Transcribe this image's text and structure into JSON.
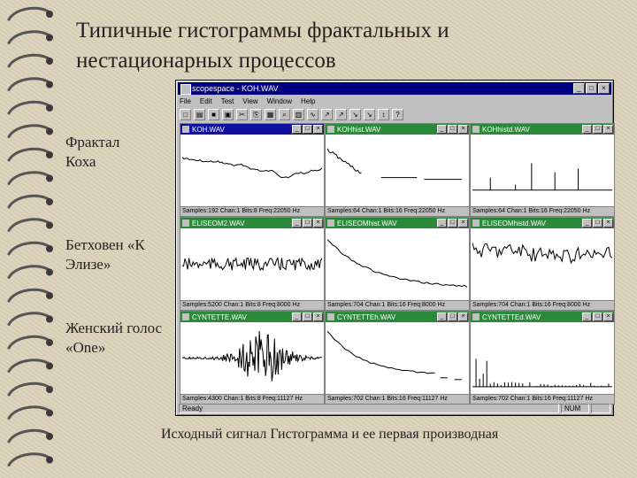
{
  "slide": {
    "title": "Типичные гистограммы фрактальных и нестационарных процессов",
    "labels": [
      "Фрактал Коха",
      "Бетховен «К Элизе»",
      "Женский голос «One»"
    ],
    "caption": "Исходный сигнал   Гистограмма и ее первая производная"
  },
  "app": {
    "title": "scopespace - KOH.WAV",
    "menu": [
      "File",
      "Edit",
      "Test",
      "View",
      "Window",
      "Help"
    ],
    "toolbar_icons": [
      "new-icon",
      "open-icon",
      "save-icon",
      "print-icon",
      "cut-icon",
      "copy-icon",
      "paste-icon",
      "zoom-icon",
      "histogram-icon",
      "wave-icon",
      "tool-icon",
      "tool-icon",
      "tool-icon",
      "tool-icon",
      "tool-icon",
      "help-icon"
    ],
    "status": {
      "ready": "Ready",
      "num": "NUM"
    }
  },
  "panes": [
    {
      "title": "KOH.WAV",
      "status": "Samples:192 Chan:1 Bits:8 Freq:22050 Hz",
      "active": true
    },
    {
      "title": "KOHhist.WAV",
      "status": "Samples:64 Chan:1 Bits:16 Freq:22050 Hz",
      "active": false
    },
    {
      "title": "KOHhistd.WAV",
      "status": "Samples:64 Chan:1 Bits:16 Freq:22050 Hz",
      "active": false
    },
    {
      "title": "ELISEOM2.WAV",
      "status": "Samples:5200 Chan:1 Bits:8 Freq:8000 Hz",
      "active": false
    },
    {
      "title": "ELISEOMhist.WAV",
      "status": "Samples:704 Chan:1 Bits:16 Freq:8000 Hz",
      "active": false
    },
    {
      "title": "ELISEOMhistd.WAV",
      "status": "Samples:704 Chan:1 Bits:16 Freq:8000 Hz",
      "active": false
    },
    {
      "title": "CYNTETTE.WAV",
      "status": "Samples:4300 Chan:1 Bits:8 Freq:11127 Hz",
      "active": false
    },
    {
      "title": "CYNTETTEh.WAV",
      "status": "Samples:702 Chan:1 Bits:16 Freq:11127 Hz",
      "active": false
    },
    {
      "title": "CYNTETTEd.WAV",
      "status": "Samples:702 Chan:1 Bits:16 Freq:11127 Hz",
      "active": false
    }
  ]
}
